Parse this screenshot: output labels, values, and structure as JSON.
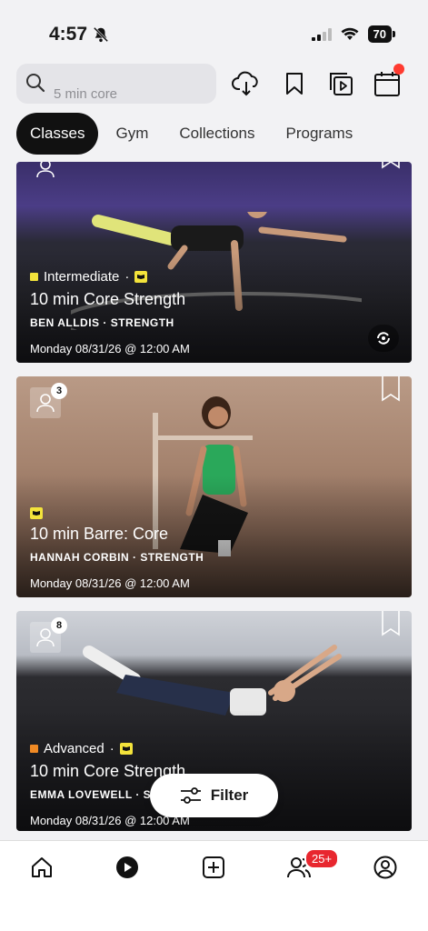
{
  "status": {
    "time": "4:57",
    "battery": "70"
  },
  "search": {
    "placeholder": "5 min core"
  },
  "tabs": [
    "Classes",
    "Gym",
    "Collections",
    "Programs"
  ],
  "cards": [
    {
      "level": "Intermediate",
      "level_color": "#f3e33b",
      "title": "10 min Core Strength",
      "instructor": "BEN ALLDIS · STRENGTH",
      "date": "Monday 08/31/26 @ 12:00 AM"
    },
    {
      "participants": "3",
      "title": "10 min Barre: Core",
      "instructor": "HANNAH CORBIN · STRENGTH",
      "date": "Monday 08/31/26 @ 12:00 AM"
    },
    {
      "participants": "8",
      "level": "Advanced",
      "level_color": "#f08a24",
      "title": "10 min Core Strength",
      "instructor": "EMMA LOVEWELL · STRENGTH",
      "date": "Monday 08/31/26 @ 12:00 AM"
    }
  ],
  "filter": {
    "label": "Filter"
  },
  "tabbar": {
    "badge": "25+"
  }
}
